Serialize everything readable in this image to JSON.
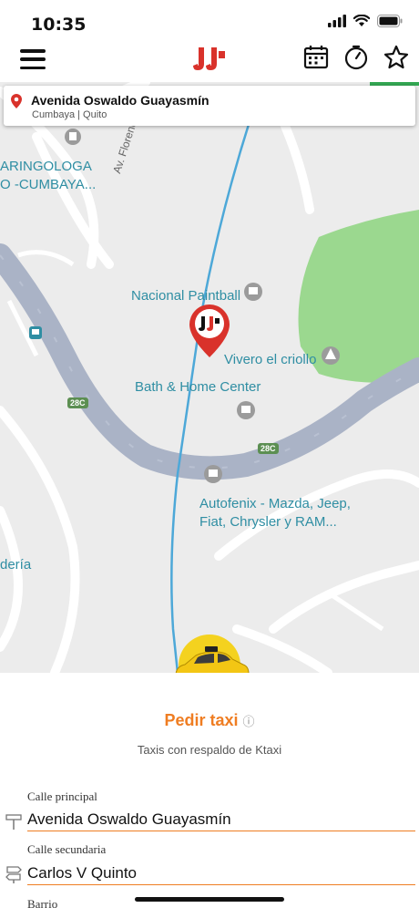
{
  "status_bar": {
    "time": "10:35"
  },
  "address_card": {
    "title": "Avenida Oswaldo Guayasmín",
    "subtitle": "Cumbaya | Quito"
  },
  "map": {
    "labels": {
      "laringologa": "ARINGOLOGA",
      "cumbaya": "O -CUMBAYA...",
      "avenida": "Av. Florencia",
      "paintball": "Nacional Paintball",
      "vivero": "Vivero el criollo",
      "bath": "Bath & Home Center",
      "autofenix_1": "Autofenix - Mazda, Jeep,",
      "autofenix_2": "Fiat, Chrysler y RAM...",
      "deria": "dería",
      "route_28c_a": "28C",
      "route_28c_b": "28C"
    }
  },
  "order": {
    "title": "Pedir taxi",
    "info_icon": "ⓘ",
    "subtitle": "Taxis con respaldo de Ktaxi"
  },
  "form": {
    "calle_principal_label": "Calle principal",
    "calle_principal_value": "Avenida Oswaldo Guayasmín",
    "calle_secundaria_label": "Calle secundaria",
    "calle_secundaria_value": "Carlos V Quinto",
    "barrio_label": "Barrio"
  },
  "colors": {
    "accent": "#ef7d22",
    "brand_red": "#d9322b",
    "park_green": "#9bd88f",
    "road": "#aab3c6",
    "route": "#4da8d8"
  }
}
